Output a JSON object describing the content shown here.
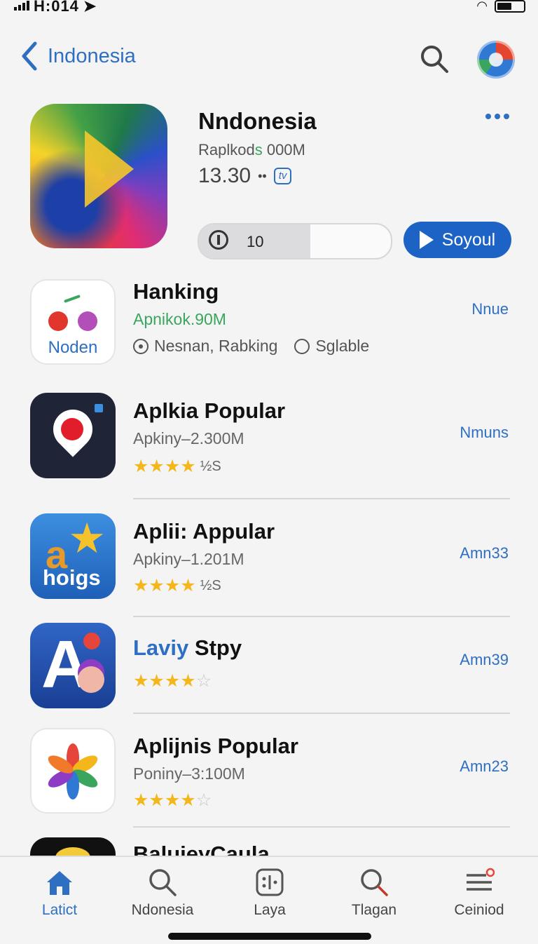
{
  "status": {
    "time": "H:014"
  },
  "nav": {
    "back_label": "Indonesia"
  },
  "featured": {
    "title": "Nndonesia",
    "subtitle_a": "Raplkod",
    "subtitle_b": "s",
    "subtitle_c": " 000M",
    "rating_text": "13.30",
    "rating_dots": "••",
    "badge": "tv",
    "progress_value": "10",
    "progress_fraction": 0.58,
    "action_label": "Soyoul"
  },
  "apps": [
    {
      "title": "Hanking",
      "subtitle": "Apnikok.90M",
      "meta_1": "Nesnan, Rabking",
      "meta_2": "Sglable",
      "action": "Nnue",
      "icon": "noden-icon",
      "icon_label": "Noden"
    },
    {
      "title": "Aplkia Popular",
      "subtitle": "Apkiny–2.300M",
      "stars": 4,
      "star_tail": "½S",
      "action": "Nmuns",
      "icon": "map-pin-icon"
    },
    {
      "title": "Aplii: Appular",
      "subtitle": "Apkiny–1.201M",
      "stars": 4,
      "star_tail": "½S",
      "action": "Amn33",
      "icon": "hoigs-icon",
      "icon_letter": "a",
      "icon_label": "hoigs"
    },
    {
      "title_blue": "Laviy",
      "title_rest": " Stpy",
      "stars": 4,
      "max_stars": 5,
      "action": "Amn39",
      "icon": "letter-a-icon",
      "icon_letter": "A"
    },
    {
      "title": "Aplijnis Popular",
      "subtitle": "Poniny–3:100M",
      "stars": 4,
      "max_stars": 5,
      "action": "Amn23",
      "icon": "flower-icon"
    },
    {
      "title": "BaluieyCaula",
      "icon": "coin-icon"
    }
  ],
  "tabs": [
    {
      "label": "Latict",
      "icon": "home-icon",
      "active": true
    },
    {
      "label": "Ndonesia",
      "icon": "search-icon"
    },
    {
      "label": "Laya",
      "icon": "apps-icon"
    },
    {
      "label": "Tlagan",
      "icon": "search-icon"
    },
    {
      "label": "Ceiniod",
      "icon": "menu-icon"
    }
  ],
  "colors": {
    "accent": "#2f6fc2",
    "cta": "#1d63c5",
    "star": "#f3b71b",
    "green": "#3aa55c"
  }
}
